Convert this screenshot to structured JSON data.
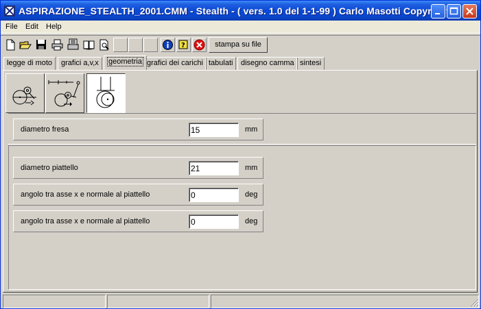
{
  "window": {
    "title": "ASPIRAZIONE_STEALTH_2001.CMM - Stealth -  ( vers. 1.0 del 1-1-99 ) Carlo Masotti Copyright ..."
  },
  "menu": {
    "items": [
      "File",
      "Edit",
      "Help"
    ]
  },
  "toolbar": {
    "icons": [
      "new-file-icon",
      "open-folder-icon",
      "save-disk-icon",
      "print-icon",
      "printer-setup-icon",
      "book-icon",
      "print-preview-icon",
      "info-icon",
      "help-icon",
      "stop-icon"
    ],
    "print_button_label": "stampa su file"
  },
  "tabs": [
    {
      "label": "legge di moto",
      "active": false
    },
    {
      "label": "grafici a,v,x",
      "active": false
    },
    {
      "label": "geometria",
      "active": true
    },
    {
      "label": "grafici dei carichi",
      "active": false
    },
    {
      "label": "tabulati",
      "active": false
    },
    {
      "label": "disegno camma",
      "active": false
    },
    {
      "label": "sintesi",
      "active": false
    }
  ],
  "follower_types": {
    "selected": "flat-follower",
    "options": [
      "roller-follower",
      "lever-roller-follower",
      "flat-follower"
    ]
  },
  "fields": {
    "diametro_fresa": {
      "label": "diametro fresa",
      "value": "15",
      "unit": "mm"
    },
    "diametro_piattello": {
      "label": "diametro piattello",
      "value": "21",
      "unit": "mm"
    },
    "angolo_1": {
      "label": "angolo tra asse x e normale al piattello",
      "value": "0",
      "unit": "deg"
    },
    "angolo_2": {
      "label": "angolo tra asse x e normale al piattello",
      "value": "0",
      "unit": "deg"
    }
  },
  "colors": {
    "titlebar": "#0a45c8",
    "face": "#d4d0c8",
    "close_button": "#c8391b"
  }
}
